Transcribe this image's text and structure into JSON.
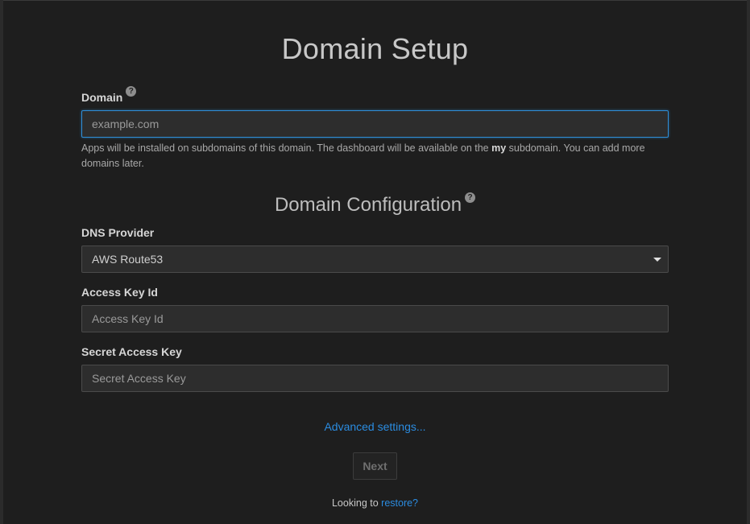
{
  "page": {
    "title": "Domain Setup"
  },
  "domain": {
    "label": "Domain",
    "placeholder": "example.com",
    "help_before": "Apps will be installed on subdomains of this domain. The dashboard will be available on the ",
    "help_bold": "my",
    "help_after": " subdomain. You can add more domains later."
  },
  "config": {
    "title": "Domain Configuration"
  },
  "dns_provider": {
    "label": "DNS Provider",
    "selected": "AWS Route53"
  },
  "access_key": {
    "label": "Access Key Id",
    "placeholder": "Access Key Id"
  },
  "secret_key": {
    "label": "Secret Access Key",
    "placeholder": "Secret Access Key"
  },
  "advanced_link": "Advanced settings...",
  "next_button": "Next",
  "restore": {
    "prefix": "Looking to ",
    "link": "restore?"
  },
  "help_icon_glyph": "?",
  "colors": {
    "accent": "#2b8ce0",
    "focus_border": "#2f8fd8",
    "background": "#1e1e1e"
  }
}
